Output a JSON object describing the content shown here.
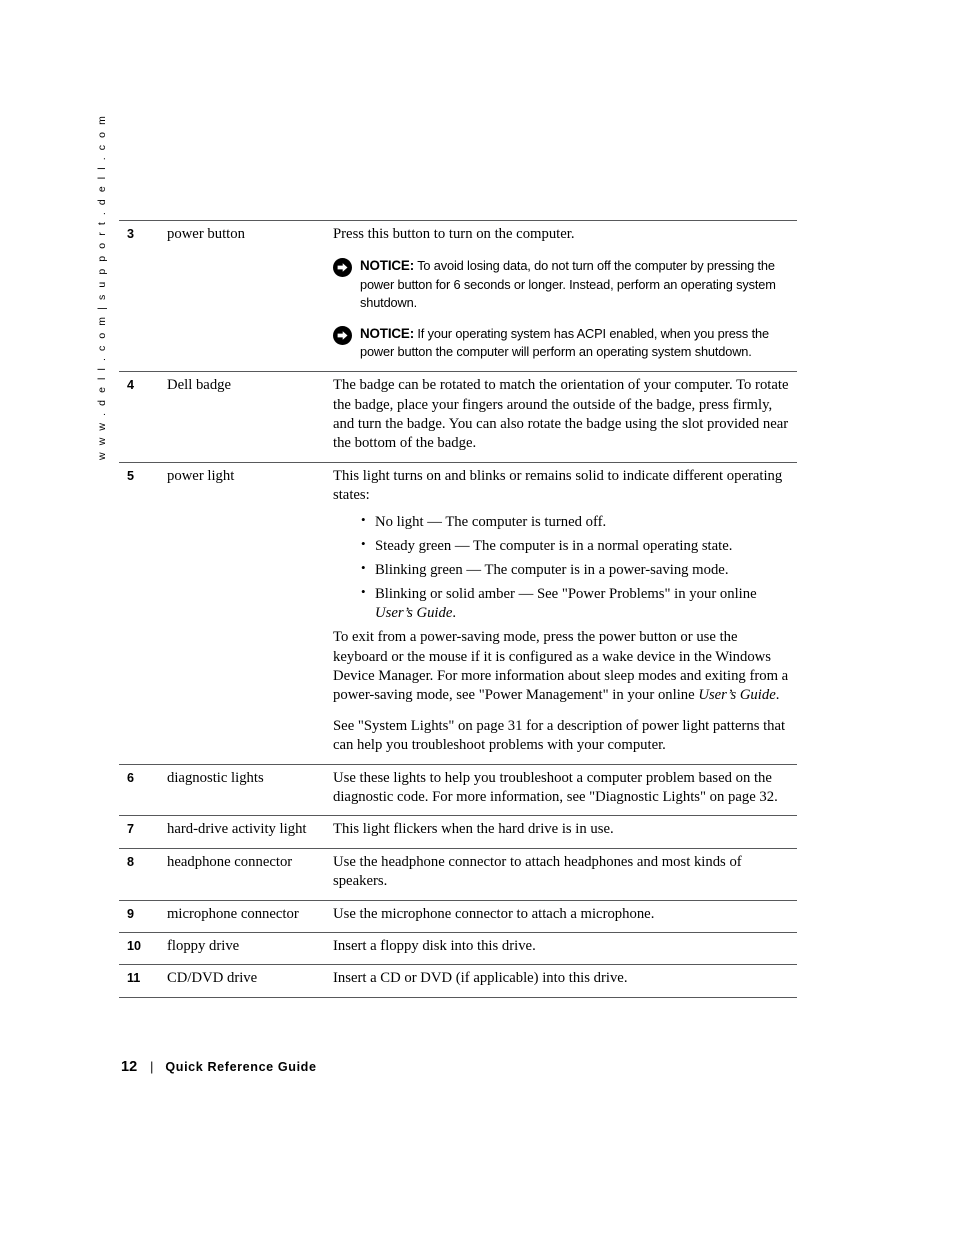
{
  "side_header": "w w w . d e l l . c o m  |  s u p p o r t . d e l l . c o m",
  "footer": {
    "page_number": "12",
    "separator": "|",
    "title": "Quick Reference Guide"
  },
  "table": {
    "rows": [
      {
        "num": "3",
        "name": "power button",
        "desc_intro": "Press this button to turn on the computer.",
        "notices": [
          {
            "label": "NOTICE:",
            "text": "To avoid losing data, do not turn off the computer by pressing the power button for 6 seconds or longer. Instead, perform an operating system shutdown."
          },
          {
            "label": "NOTICE:",
            "text": "If your operating system has ACPI enabled, when you press the power button the computer will perform an operating system shutdown."
          }
        ]
      },
      {
        "num": "4",
        "name": "Dell badge",
        "desc": "The badge can be rotated to match the orientation of your computer. To rotate the badge, place your fingers around the outside of the badge, press firmly, and turn the badge. You can also rotate the badge using the slot provided near the bottom of the badge."
      },
      {
        "num": "5",
        "name": "power light",
        "desc_intro": "This light turns on and blinks or remains solid to indicate different operating states:",
        "bullets": [
          "No light — The computer is turned off.",
          "Steady green — The computer is in a normal operating state.",
          "Blinking green — The computer is in a power-saving mode.",
          "Blinking or solid amber — See \"Power Problems\" in your online "
        ],
        "bullet4_italic": "User’s Guide",
        "bullet4_tail": ".",
        "para2_a": "To exit from a power-saving mode, press the power button or use the keyboard or the mouse if it is configured as a wake device in the Windows Device Manager. For more information about sleep modes and exiting from a power-saving mode, see \"Power Management\" in your online ",
        "para2_italic": "User’s Guide",
        "para2_tail": ".",
        "para3": "See \"System Lights\" on page 31 for a description of power light patterns that can help you troubleshoot problems with your computer."
      },
      {
        "num": "6",
        "name": "diagnostic lights",
        "desc": "Use these lights to help you troubleshoot a computer problem based on the diagnostic code. For more information, see \"Diagnostic Lights\" on page 32."
      },
      {
        "num": "7",
        "name": "hard-drive activity light",
        "desc": "This light flickers when the hard drive is in use."
      },
      {
        "num": "8",
        "name": "headphone connector",
        "desc": "Use the headphone connector to attach headphones and most kinds of speakers."
      },
      {
        "num": "9",
        "name": "microphone connector",
        "desc": "Use the microphone connector to attach a microphone."
      },
      {
        "num": "10",
        "name": "floppy drive",
        "desc": "Insert a floppy disk into this drive."
      },
      {
        "num": "11",
        "name": "CD/DVD drive",
        "desc": "Insert a CD or DVD (if applicable) into this drive."
      }
    ]
  },
  "icons": {
    "notice": "notice-arrow-icon"
  },
  "colors": {
    "text": "#000000",
    "rule": "#58595b",
    "page_bg": "#ffffff"
  }
}
